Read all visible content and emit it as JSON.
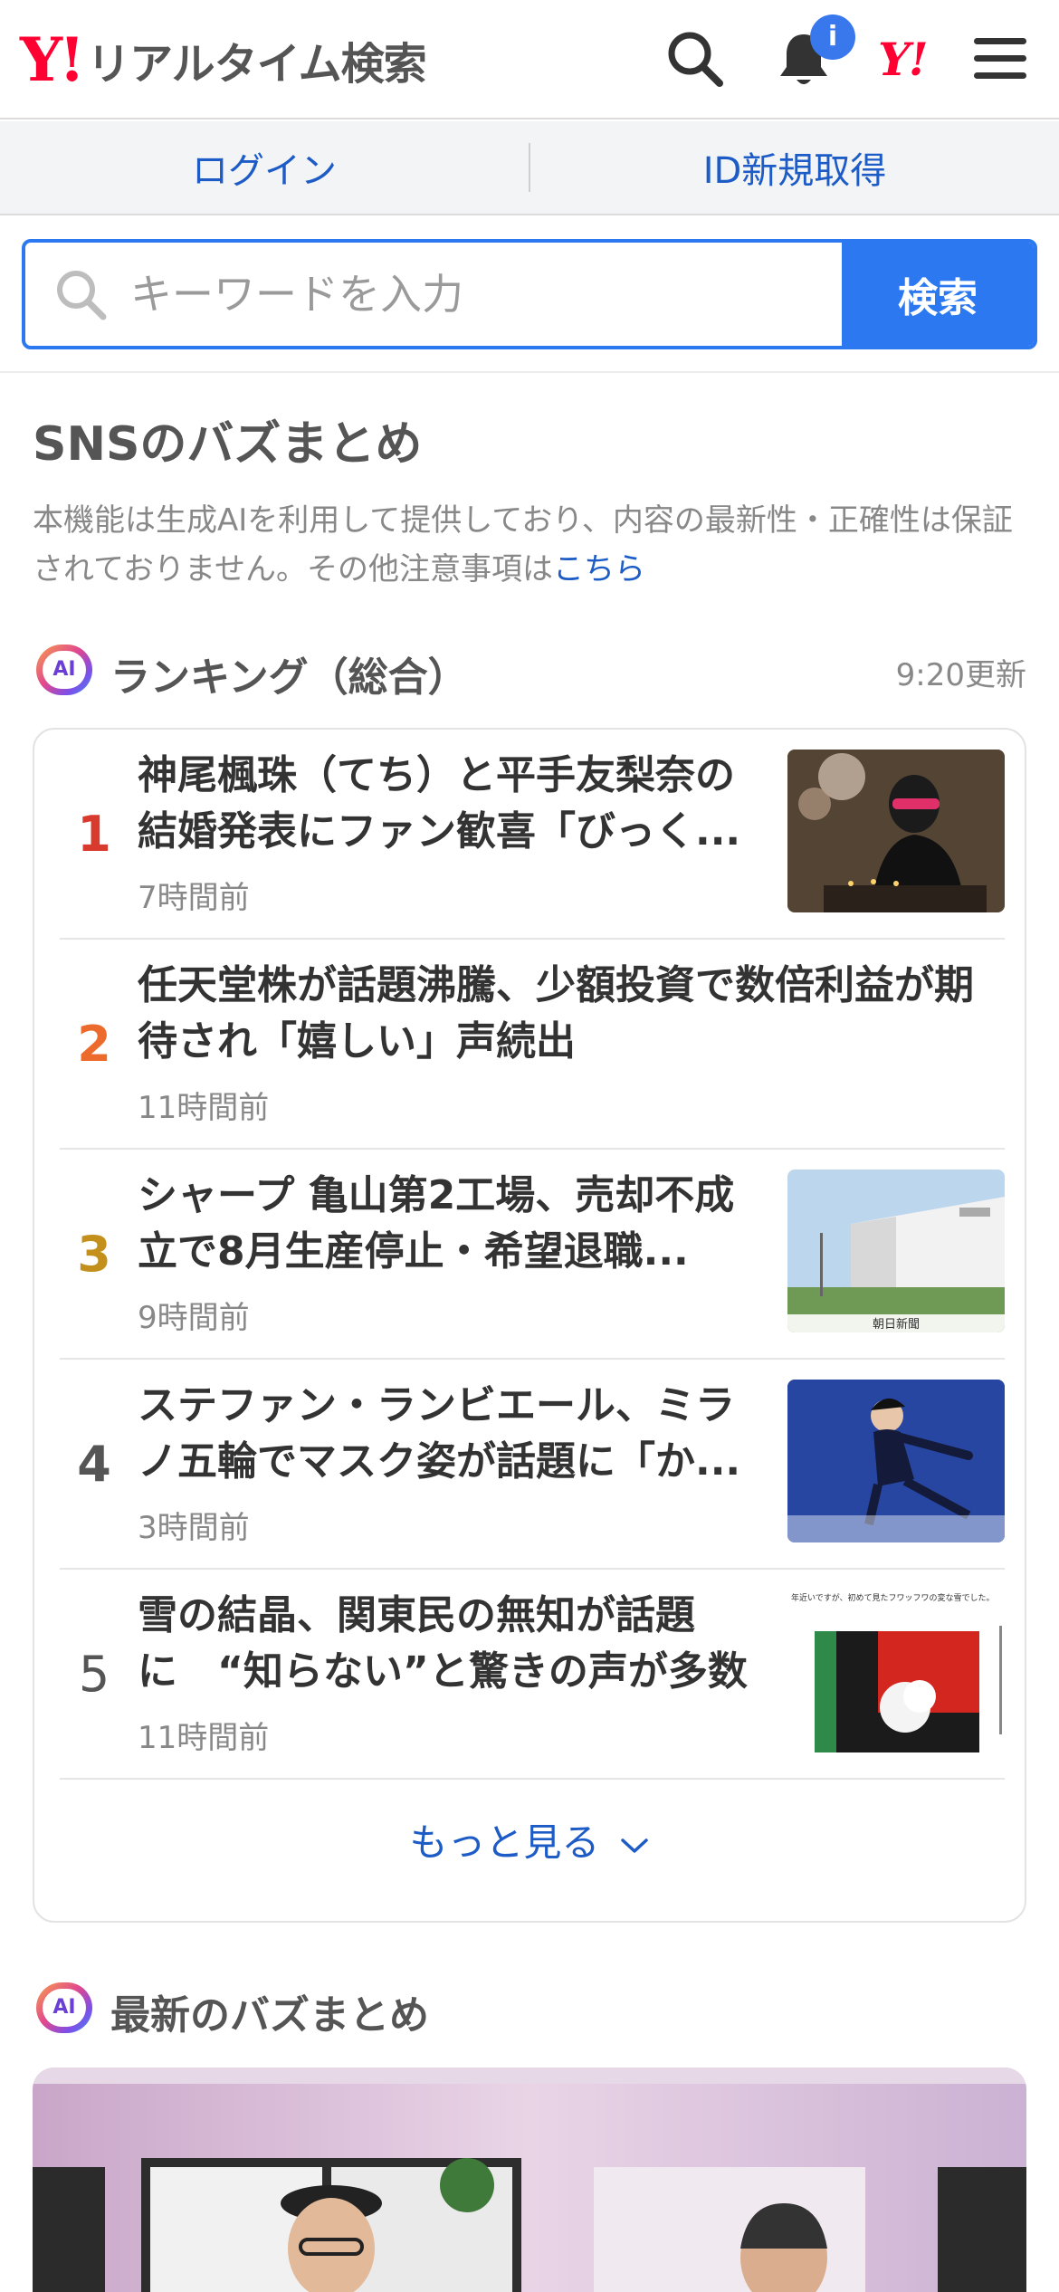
{
  "header": {
    "logo_mark": "Y!",
    "logo_text": "リアルタイム検索",
    "notification_badge": "i",
    "yj_mark": "Y!"
  },
  "loginbar": {
    "login": "ログイン",
    "signup": "ID新規取得"
  },
  "search": {
    "placeholder": "キーワードを入力",
    "button": "検索"
  },
  "sns_section": {
    "title": "SNSのバズまとめ",
    "disclaimer": "本機能は生成AIを利用して提供しており、内容の最新性・正確性は保証されておりません。その他注意事項は",
    "disclaimer_link": "こちら"
  },
  "ranking": {
    "ai_badge": "AI",
    "heading": "ランキング（総合）",
    "updated": "9:20更新",
    "items": [
      {
        "rank": "1",
        "title_l1": "神尾楓珠（てち）と平手友梨奈の",
        "title_l2": "結婚発表にファン歓喜「びっく...",
        "time": "7時間前",
        "rank_color": "#d83a2e"
      },
      {
        "rank": "2",
        "title_l1": "任天堂株が話題沸騰、少額投資で数倍利益が期",
        "title_l2": "待され「嬉しい」声続出",
        "time": "11時間前",
        "rank_color": "#ec6a2c"
      },
      {
        "rank": "3",
        "title_l1": "シャープ 亀山第2工場、売却不成",
        "title_l2": "立で8月生産停止・希望退職...",
        "time": "9時間前",
        "rank_color": "#c4901c",
        "thumb_caption": "朝日新聞"
      },
      {
        "rank": "4",
        "title_l1": "ステファン・ランビエール、ミラ",
        "title_l2": "ノ五輪でマスク姿が話題に「か...",
        "time": "3時間前",
        "rank_color": "#555555"
      },
      {
        "rank": "5",
        "title_l1": "雪の結晶、関東民の無知が話題",
        "title_l2": "に　“知らない”と驚きの声が多数",
        "time": "11時間前",
        "rank_color": "#555555",
        "thumb_caption": "年近いですが、初めて見たフワッフワの変な雪でした。"
      }
    ],
    "more": "もっと見る"
  },
  "latest": {
    "ai_badge": "AI",
    "heading": "最新のバズまとめ"
  }
}
